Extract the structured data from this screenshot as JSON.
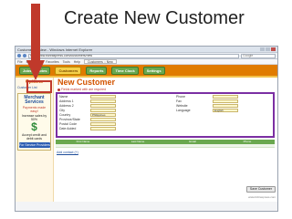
{
  "slide": {
    "title": "Create New Customer"
  },
  "browser": {
    "window_title": "Customers :: New - Windows Internet Explorer",
    "url": "http://www.biztraxpress.com/customers/new",
    "search_placeholder": "Google",
    "tab_label": "Customers :: New",
    "menu": [
      "File",
      "Edit",
      "View",
      "Favorites",
      "Tools",
      "Help"
    ]
  },
  "nav": {
    "tabs": [
      {
        "label": "Jobs / Quotes"
      },
      {
        "label": "Customers"
      },
      {
        "label": "Reports"
      },
      {
        "label": "Time Clock"
      },
      {
        "label": "Settings"
      }
    ]
  },
  "sidebar": {
    "options_label": "Options",
    "link_label": "Customer List",
    "ad": {
      "title": "Merchant Services",
      "subtitle": "Payments made easy!",
      "line1": "Increase sales by 50%",
      "symbol": "$",
      "line2": "Accept credit and debit cards",
      "button": "For Service Providers"
    }
  },
  "form": {
    "heading": "New Customer",
    "required_note": "Fields marked with  are required",
    "left_fields": [
      {
        "label": "Name"
      },
      {
        "label": "Address 1"
      },
      {
        "label": "Address 2"
      },
      {
        "label": "City"
      },
      {
        "label": "Country",
        "value": "Philippines"
      },
      {
        "label": "Province/State"
      },
      {
        "label": "Postal Code"
      },
      {
        "label": "Date Added"
      }
    ],
    "right_fields": [
      {
        "label": "Phone"
      },
      {
        "label": "Fax"
      },
      {
        "label": "Website"
      },
      {
        "label": "Language",
        "value": "English"
      }
    ],
    "grid_columns": [
      "First Name",
      "Last Name",
      "Email",
      "Phone"
    ],
    "add_contact": "Add contact (+)",
    "save_button": "Save Customer",
    "footer": "www.biztraxpress.com"
  },
  "annotations": {
    "arrow_color": "#c0392b",
    "frame_color": "#7b2fa3"
  }
}
